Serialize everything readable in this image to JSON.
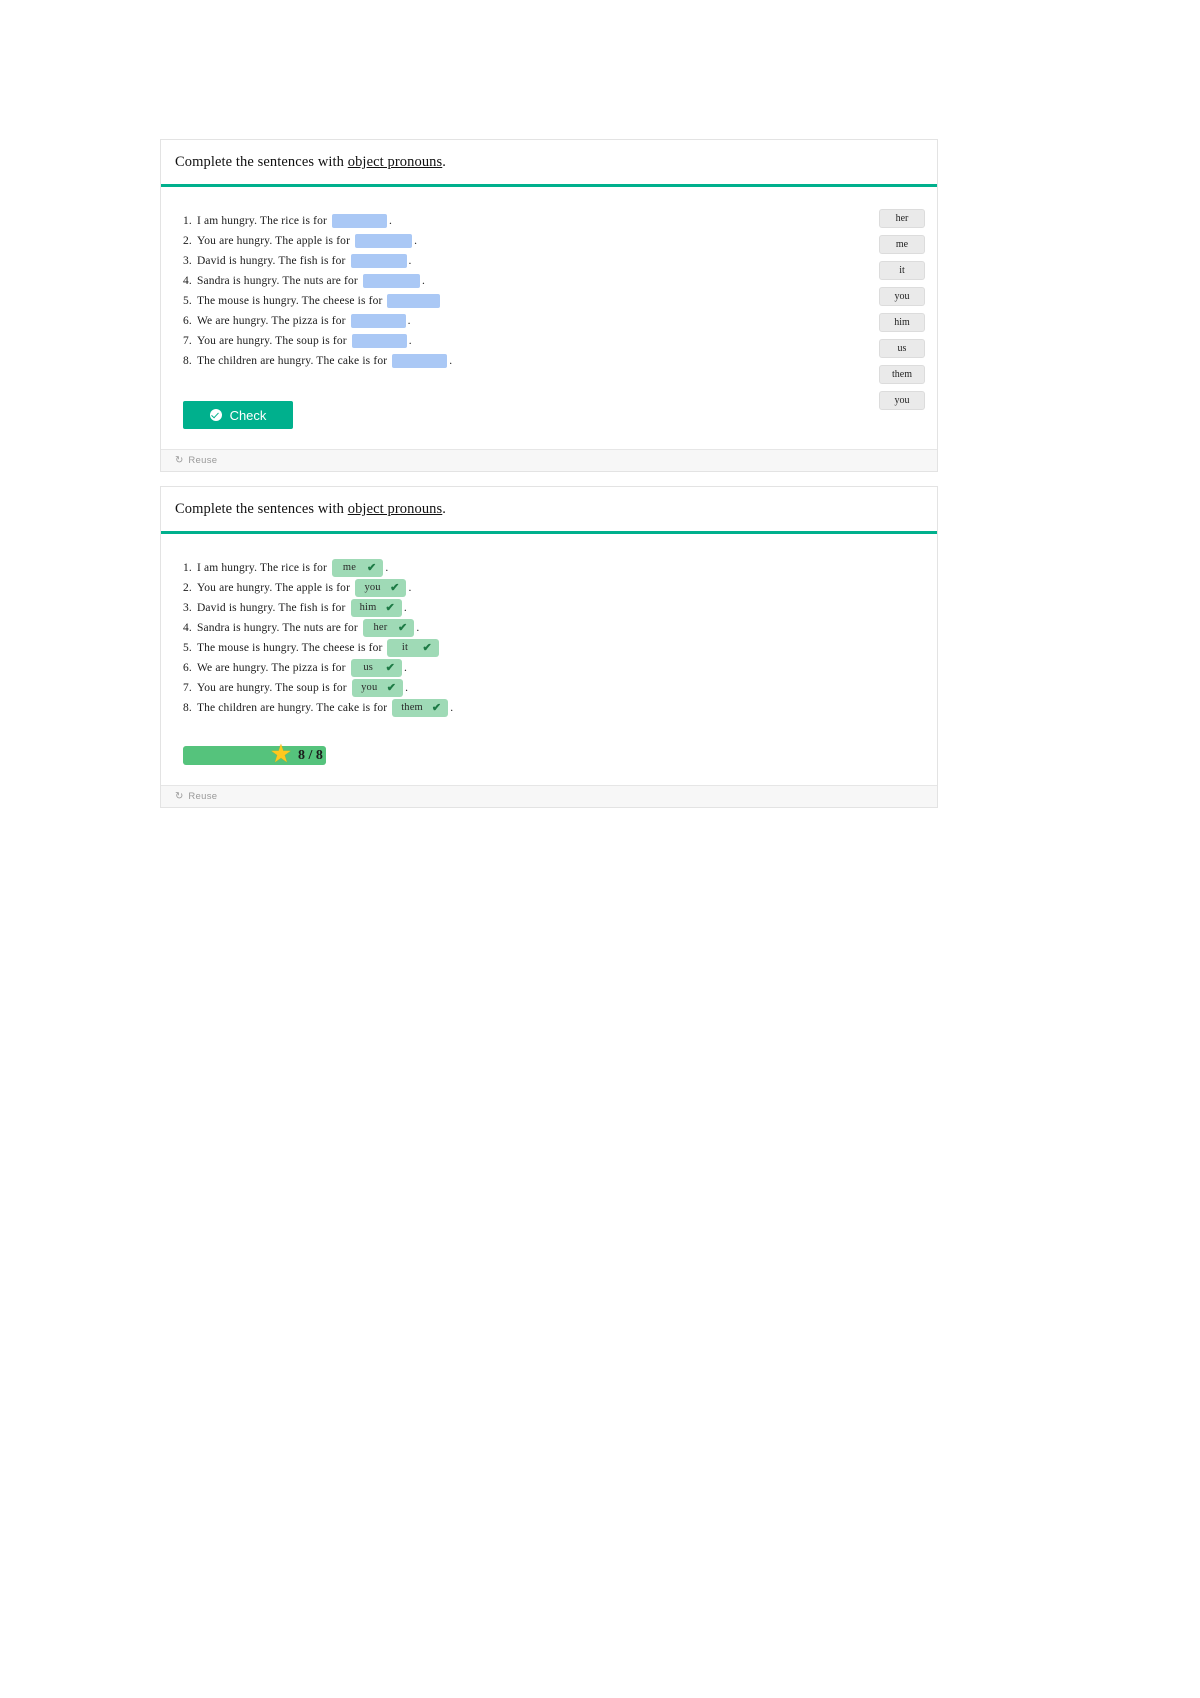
{
  "exercise": {
    "title_prefix": "Complete the sentences with ",
    "title_emphasis": "object pronouns",
    "title_suffix": "."
  },
  "card_unanswered": {
    "sentences": [
      {
        "num": "1.",
        "text": "I am hungry. The rice is for",
        "blank_width": 55,
        "tail": "."
      },
      {
        "num": "2.",
        "text": "You are hungry. The apple is for",
        "blank_width": 57,
        "tail": "."
      },
      {
        "num": "3.",
        "text": "David is hungry. The fish is for",
        "blank_width": 56,
        "tail": "."
      },
      {
        "num": "4.",
        "text": "Sandra is hungry. The nuts are for",
        "blank_width": 57,
        "tail": "."
      },
      {
        "num": "5.",
        "text": "The mouse is hungry. The cheese is for",
        "blank_width": 53,
        "tail": ""
      },
      {
        "num": "6.",
        "text": "We are hungry. The pizza is for",
        "blank_width": 55,
        "tail": "."
      },
      {
        "num": "7.",
        "text": "You are hungry. The soup is for",
        "blank_width": 55,
        "tail": "."
      },
      {
        "num": "8.",
        "text": "The children are hungry. The cake is for",
        "blank_width": 55,
        "tail": "."
      }
    ],
    "wordbank": [
      "her",
      "me",
      "it",
      "you",
      "him",
      "us",
      "them",
      "you"
    ],
    "check_label": "Check",
    "check_icon": "check-circle-icon",
    "reuse_label": "Reuse",
    "reuse_icon": "reuse-icon"
  },
  "card_answered": {
    "sentences": [
      {
        "num": "1.",
        "text": "I am hungry. The rice is for",
        "answer": "me",
        "tail": "."
      },
      {
        "num": "2.",
        "text": "You are hungry. The apple is for",
        "answer": "you",
        "tail": "."
      },
      {
        "num": "3.",
        "text": "David is hungry. The fish is for",
        "answer": "him",
        "tail": "."
      },
      {
        "num": "4.",
        "text": "Sandra is hungry. The nuts are for",
        "answer": "her",
        "tail": "."
      },
      {
        "num": "5.",
        "text": "The mouse is hungry. The cheese is for",
        "answer": "it",
        "tail": ""
      },
      {
        "num": "6.",
        "text": "We are hungry. The pizza is for",
        "answer": "us",
        "tail": "."
      },
      {
        "num": "7.",
        "text": "You are hungry. The soup is for",
        "answer": "you",
        "tail": "."
      },
      {
        "num": "8.",
        "text": "The children are hungry. The cake is for",
        "answer": "them",
        "tail": "."
      }
    ],
    "tick_glyph": "✔",
    "score": {
      "text": "8 / 8",
      "percent": 100,
      "star_glyph": "★"
    },
    "reuse_label": "Reuse",
    "reuse_icon": "reuse-icon"
  },
  "colors": {
    "accent": "#00b08d",
    "blank": "#aac8f5",
    "answer_bg": "#9fdab6",
    "tick": "#1d7a45",
    "score_fill": "#55c37c",
    "star": "#ffc81e",
    "chip_bg": "#eaeaea"
  }
}
